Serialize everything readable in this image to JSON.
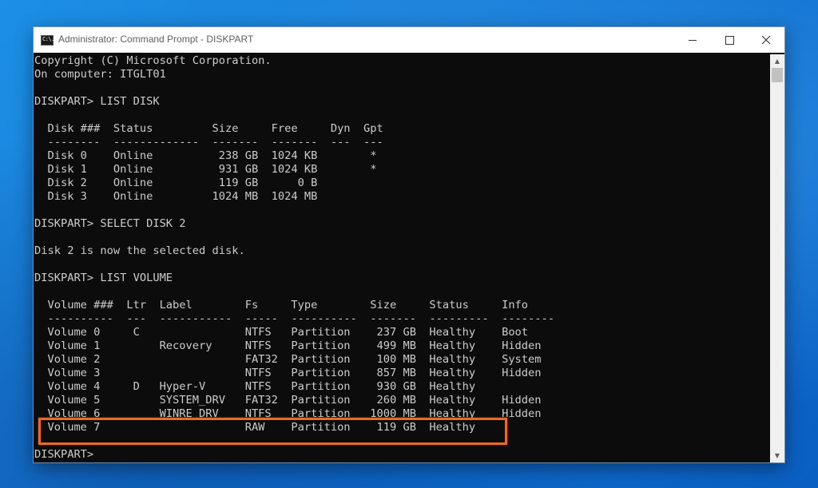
{
  "window": {
    "title": "Administrator: Command Prompt - DISKPART",
    "icon_label": "C:\\.",
    "controls": {
      "minimize_icon": "minimize-icon",
      "maximize_icon": "maximize-icon",
      "close_icon": "close-icon"
    }
  },
  "console": {
    "lines": [
      "Copyright (C) Microsoft Corporation.",
      "On computer: ITGLT01",
      "",
      "DISKPART> LIST DISK",
      "",
      "  Disk ###  Status         Size     Free     Dyn  Gpt",
      "  --------  -------------  -------  -------  ---  ---",
      "  Disk 0    Online          238 GB  1024 KB        *",
      "  Disk 1    Online          931 GB  1024 KB        *",
      "  Disk 2    Online          119 GB      0 B",
      "  Disk 3    Online         1024 MB  1024 MB",
      "",
      "DISKPART> SELECT DISK 2",
      "",
      "Disk 2 is now the selected disk.",
      "",
      "DISKPART> LIST VOLUME",
      "",
      "  Volume ###  Ltr  Label        Fs     Type        Size     Status     Info",
      "  ----------  ---  -----------  -----  ----------  -------  ---------  --------",
      "  Volume 0     C                NTFS   Partition    237 GB  Healthy    Boot",
      "  Volume 1         Recovery     NTFS   Partition    499 MB  Healthy    Hidden",
      "  Volume 2                      FAT32  Partition    100 MB  Healthy    System",
      "  Volume 3                      NTFS   Partition    857 MB  Healthy    Hidden",
      "  Volume 4     D   Hyper-V      NTFS   Partition    930 GB  Healthy",
      "  Volume 5         SYSTEM_DRV   FAT32  Partition    260 MB  Healthy    Hidden",
      "  Volume 6         WINRE_DRV    NTFS   Partition   1000 MB  Healthy    Hidden",
      "  Volume 7                      RAW    Partition    119 GB  Healthy",
      "",
      "DISKPART>"
    ]
  },
  "scrollbar": {
    "up_arrow": "▲",
    "down_arrow": "▼"
  },
  "colors": {
    "console_bg": "#0c0c0c",
    "console_text": "#cccccc",
    "highlight_border": "#e86a2a",
    "desktop_blue": "#1a82da"
  }
}
